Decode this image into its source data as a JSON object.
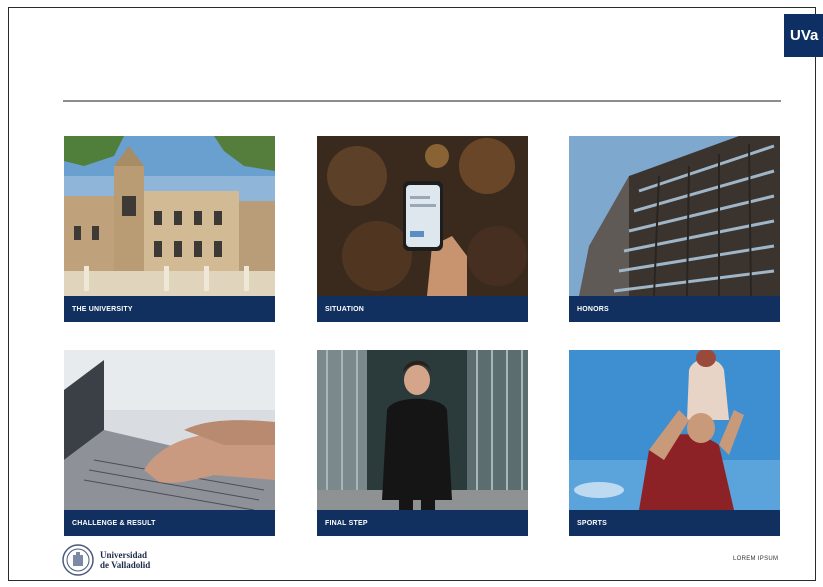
{
  "brand": {
    "tab_label": "UVa"
  },
  "tiles": [
    {
      "caption": "THE UNIVERSITY",
      "icon": "university-building-photo"
    },
    {
      "caption": "SITUATION",
      "icon": "phone-in-hand-photo"
    },
    {
      "caption": "HONORS",
      "icon": "tower-building-photo"
    },
    {
      "caption": "CHALLENGE & RESULT",
      "icon": "typing-laptop-photo"
    },
    {
      "caption": "FINAL STEP",
      "icon": "student-portrait-photo"
    },
    {
      "caption": "SPORTS",
      "icon": "cheer-lift-photo"
    }
  ],
  "footer": {
    "logo_line1": "Universidad",
    "logo_line2": "de Valladolid",
    "link": "LOREM IPSUM"
  },
  "colors": {
    "navy": "#11305f",
    "rule": "#8d8d8d"
  }
}
